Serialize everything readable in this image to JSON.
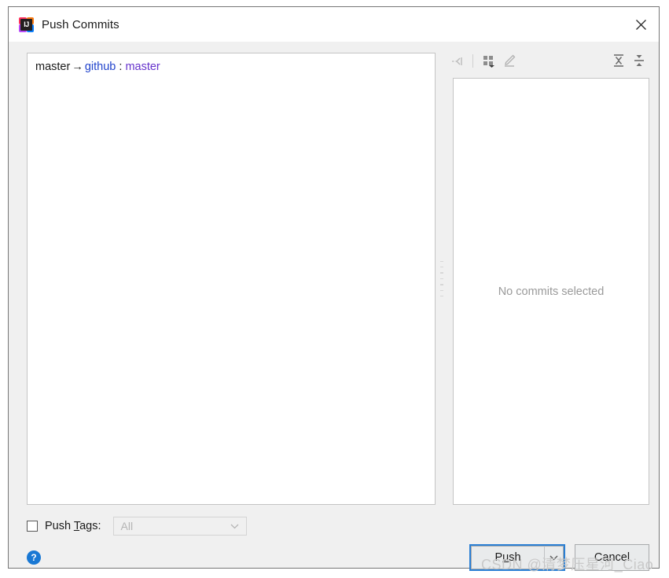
{
  "window": {
    "title": "Push Commits",
    "app_icon": "intellij-idea-icon",
    "icon_text": "IJ",
    "close_icon": "close-icon"
  },
  "commits_panel": {
    "branch": {
      "source": "master",
      "arrow": "→",
      "remote": "github",
      "separator": ":",
      "target": "master"
    }
  },
  "detail_toolbar": {
    "buttons": [
      {
        "name": "collapse-selection-icon",
        "title": ""
      },
      {
        "name": "group-by-icon",
        "title": ""
      },
      {
        "name": "edit-icon",
        "title": ""
      },
      {
        "name": "expand-all-icon",
        "title": ""
      },
      {
        "name": "collapse-all-icon",
        "title": ""
      }
    ]
  },
  "detail_panel": {
    "empty_message": "No commits selected"
  },
  "push_tags": {
    "checkbox_checked": false,
    "label_prefix": "Push ",
    "label_mnemonic": "T",
    "label_suffix": "ags:",
    "dropdown_value": "All",
    "dropdown_enabled": false
  },
  "footer": {
    "help_label": "?",
    "push_prefix": "P",
    "push_mnemonic": "u",
    "push_suffix": "sh",
    "push_label": "Push",
    "push_dropdown_icon": "chevron-down-icon",
    "cancel_label": "Cancel"
  },
  "watermark": {
    "text": "CSDN @清梦压星河_Ciao"
  },
  "colors": {
    "accent": "#2a7fd4",
    "remote_link": "#2244cc",
    "target_branch": "#6633cc",
    "help_blue": "#1978d4",
    "panel_bg": "#f0f0f0"
  }
}
